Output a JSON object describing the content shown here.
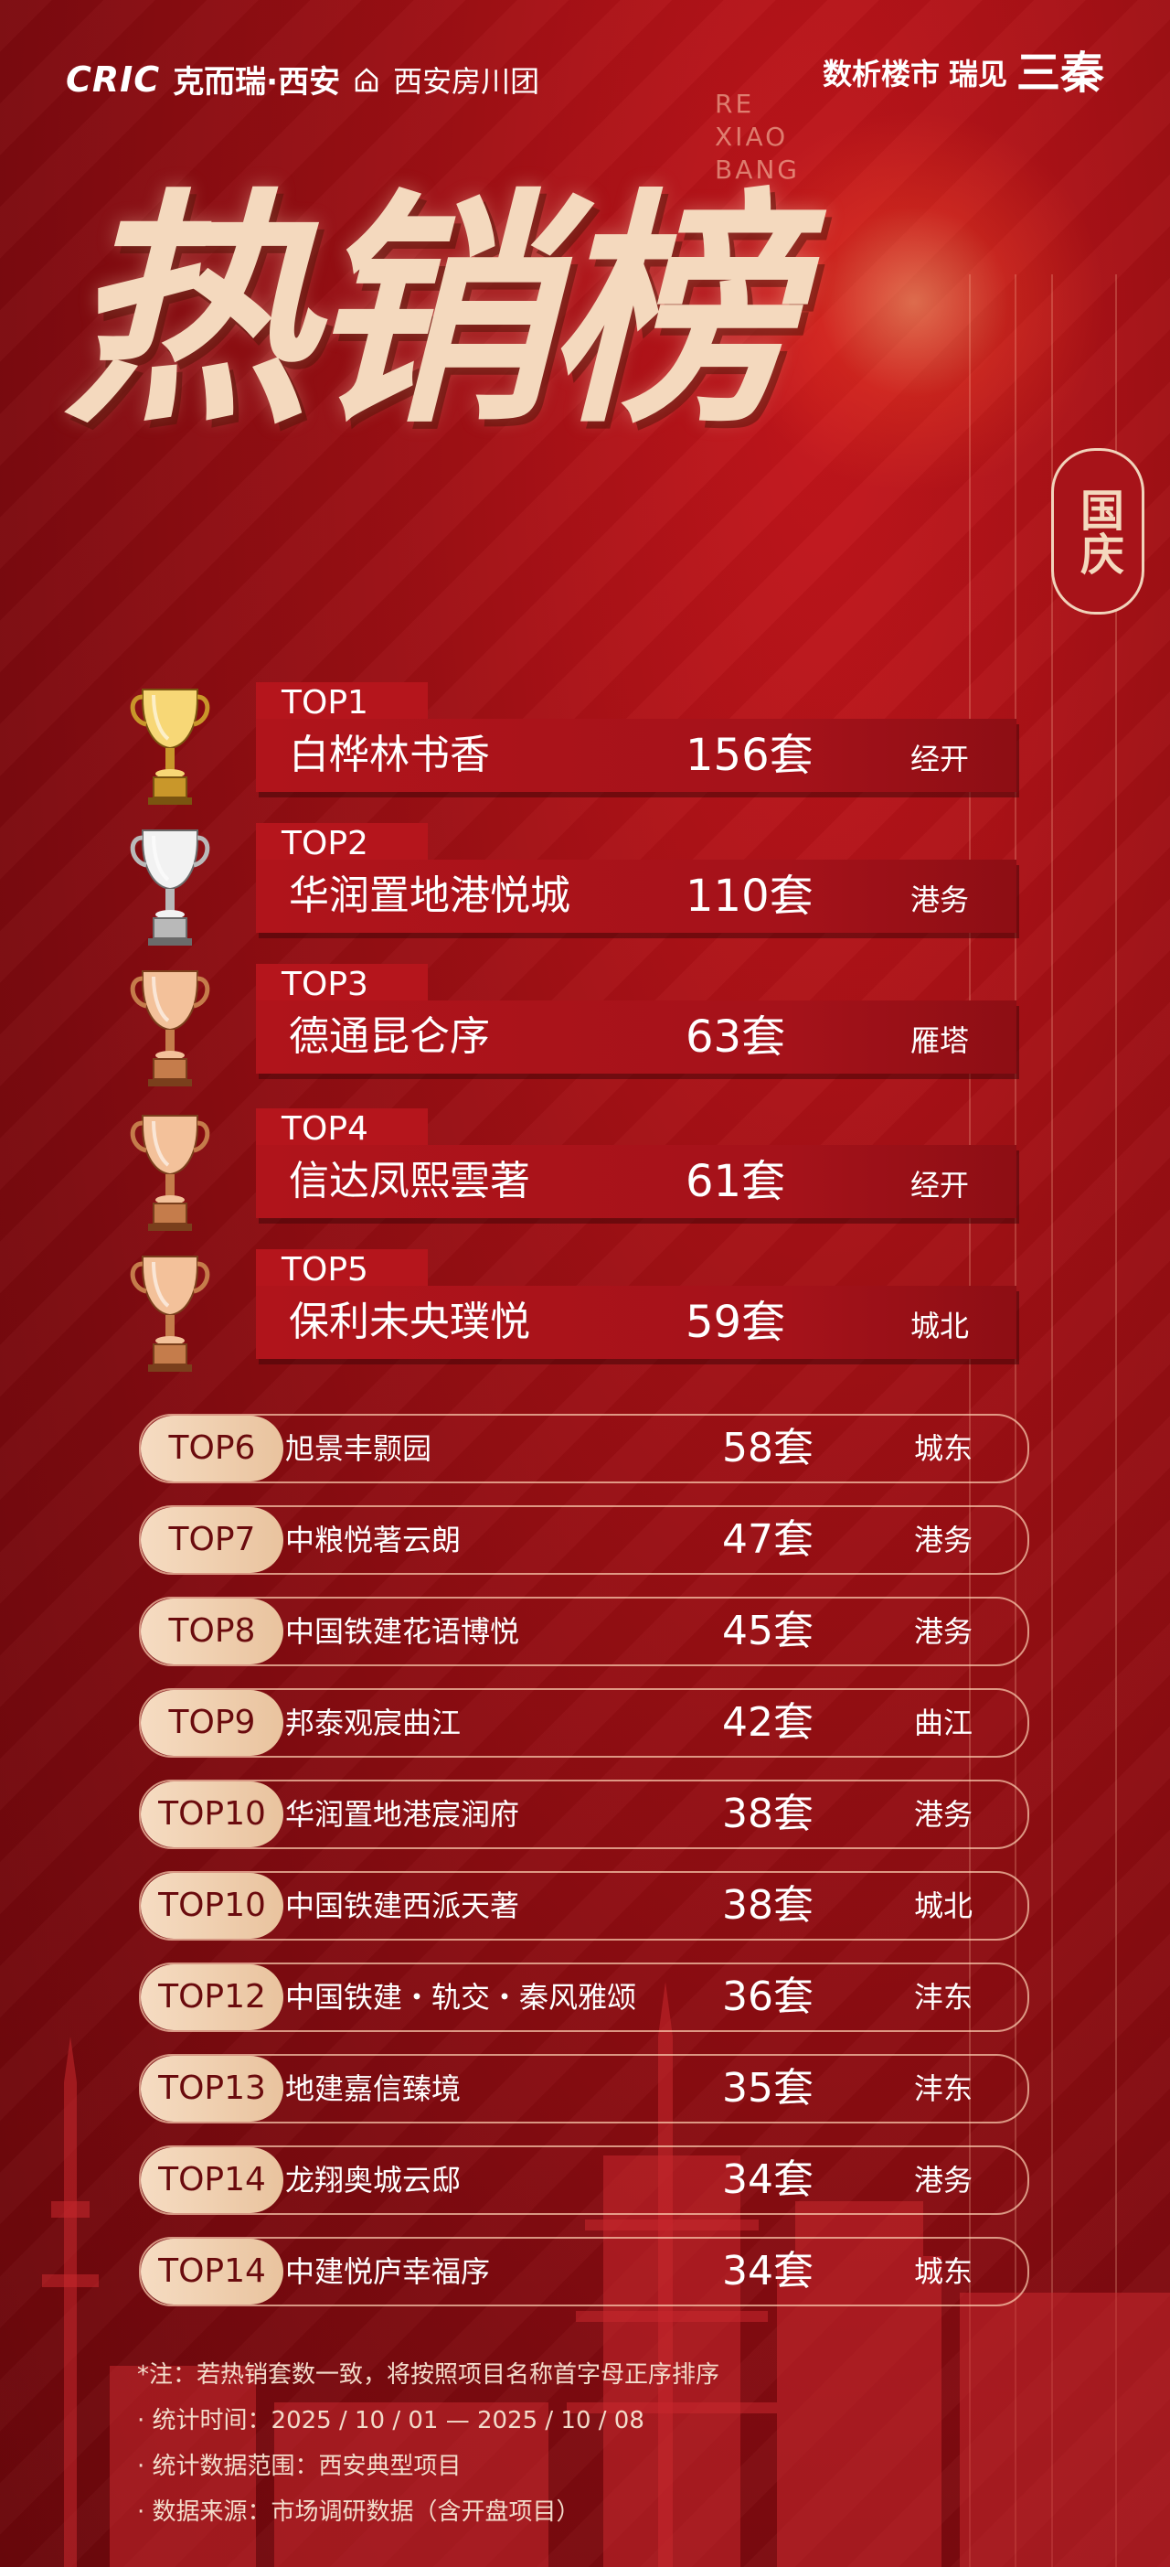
{
  "header": {
    "brand_logo": "CRIC",
    "brand_name": "克而瑞·西安",
    "brand_sub": "西安房川团",
    "slogan_a": "数析楼市",
    "slogan_b": "瑞见",
    "slogan_c": "三秦"
  },
  "pinyin": [
    "RE",
    "XIAO",
    "BANG"
  ],
  "title": "热销榜",
  "seal": "国庆",
  "colors": {
    "background": "#9d0f14",
    "gold": "#f4d9be",
    "tag": "#b5151c"
  },
  "top5": [
    {
      "rank": "TOP1",
      "name": "白桦林书香",
      "count": "156套",
      "area": "经开",
      "trophy": "gold-trophy-icon"
    },
    {
      "rank": "TOP2",
      "name": "华润置地港悦城",
      "count": "110套",
      "area": "港务",
      "trophy": "silver-trophy-icon"
    },
    {
      "rank": "TOP3",
      "name": "德通昆仑序",
      "count": "63套",
      "area": "雁塔",
      "trophy": "bronze-trophy-icon"
    },
    {
      "rank": "TOP4",
      "name": "信达凤熙雲著",
      "count": "61套",
      "area": "经开",
      "trophy": "bronze-trophy-icon"
    },
    {
      "rank": "TOP5",
      "name": "保利未央璞悦",
      "count": "59套",
      "area": "城北",
      "trophy": "bronze-trophy-icon"
    }
  ],
  "rest": [
    {
      "rank": "TOP6",
      "name": "旭景丰颢园",
      "count": "58套",
      "area": "城东"
    },
    {
      "rank": "TOP7",
      "name": "中粮悦著云朗",
      "count": "47套",
      "area": "港务"
    },
    {
      "rank": "TOP8",
      "name": "中国铁建花语博悦",
      "count": "45套",
      "area": "港务"
    },
    {
      "rank": "TOP9",
      "name": "邦泰观宸曲江",
      "count": "42套",
      "area": "曲江"
    },
    {
      "rank": "TOP10",
      "name": "华润置地港宸润府",
      "count": "38套",
      "area": "港务"
    },
    {
      "rank": "TOP10",
      "name": "中国铁建西派天著",
      "count": "38套",
      "area": "城北"
    },
    {
      "rank": "TOP12",
      "name": "中国铁建・轨交・秦风雅颂",
      "count": "36套",
      "area": "沣东"
    },
    {
      "rank": "TOP13",
      "name": "地建嘉信臻境",
      "count": "35套",
      "area": "沣东"
    },
    {
      "rank": "TOP14",
      "name": "龙翔奥城云邸",
      "count": "34套",
      "area": "港务"
    },
    {
      "rank": "TOP14",
      "name": "中建悦庐幸福序",
      "count": "34套",
      "area": "城东"
    }
  ],
  "notes": [
    "*注：若热销套数一致，将按照项目名称首字母正序排序",
    "· 统计时间：2025 / 10 / 01 — 2025 / 10 / 08",
    "· 统计数据范围：西安典型项目",
    "· 数据来源：市场调研数据（含开盘项目）"
  ]
}
